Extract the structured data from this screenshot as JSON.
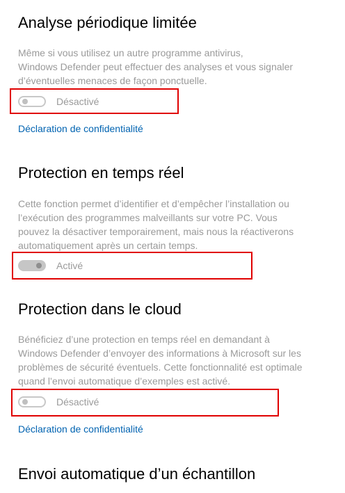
{
  "sections": [
    {
      "title": "Analyse périodique limitée",
      "description_lines": [
        "Même si vous utilisez un autre programme antivirus,",
        "Windows Defender peut effectuer des analyses et vous signaler",
        "d’éventuelles menaces de façon ponctuelle."
      ],
      "toggle_state": "off",
      "toggle_label": "Désactivé",
      "link": "Déclaration de confidentialité"
    },
    {
      "title": "Protection en temps réel",
      "description_lines": [
        "Cette fonction permet d’identifier et d’empêcher l’installation ou",
        "l’exécution des programmes malveillants sur votre PC. Vous",
        "pouvez la désactiver temporairement, mais nous la réactiverons",
        "automatiquement après un certain temps."
      ],
      "toggle_state": "on",
      "toggle_label": "Activé"
    },
    {
      "title": "Protection dans le cloud",
      "description_lines": [
        "Bénéficiez d’une protection en temps réel en demandant à",
        "Windows Defender d’envoyer des informations à Microsoft sur les",
        "problèmes de sécurité éventuels. Cette fonctionnalité est optimale",
        "quand l’envoi automatique d’exemples est activé."
      ],
      "toggle_state": "off",
      "toggle_label": "Désactivé",
      "link": "Déclaration de confidentialité"
    },
    {
      "title": "Envoi automatique d’un échantillon"
    }
  ],
  "colors": {
    "highlight": "#e00000",
    "link": "#0063b1",
    "disabled_text": "#9a9a9a"
  }
}
